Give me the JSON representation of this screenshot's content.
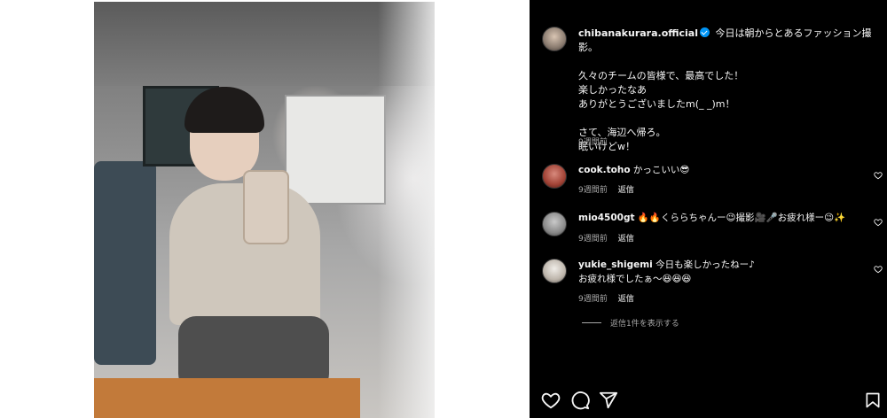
{
  "post": {
    "username": "chibanakurara.official",
    "caption": "今日は朝からとあるファッション撮影。\n\n久々のチームの皆様で、最高でした！\n楽しかったなあ\nありがとうございましたm(_ _)m！\n\nさて、海辺へ帰ろ。\n眠いけどw！",
    "time": "9週間前"
  },
  "comments": [
    {
      "username": "cook.toho",
      "text": "かっこいい😎",
      "time": "9週間前",
      "reply_label": "返信"
    },
    {
      "username": "mio4500gt",
      "text": "🔥🔥くららちゃんー😉撮影🎥🎤お疲れ様ー😉✨",
      "time": "9週間前",
      "reply_label": "返信"
    },
    {
      "username": "yukie_shigemi",
      "text": "今日も楽しかったねー♪\nお疲れ様でしたぁ〜😆😆😆",
      "time": "9週間前",
      "reply_label": "返信"
    }
  ],
  "view_replies_label": "返信1件を表示する",
  "icons": {
    "like": "heart-icon",
    "comment": "comment-icon",
    "share": "send-icon",
    "save": "bookmark-icon"
  },
  "colors": {
    "panel_bg": "#000000",
    "text": "#f5f5f5",
    "secondary": "#a8a8a8",
    "verified": "#0095f6"
  }
}
